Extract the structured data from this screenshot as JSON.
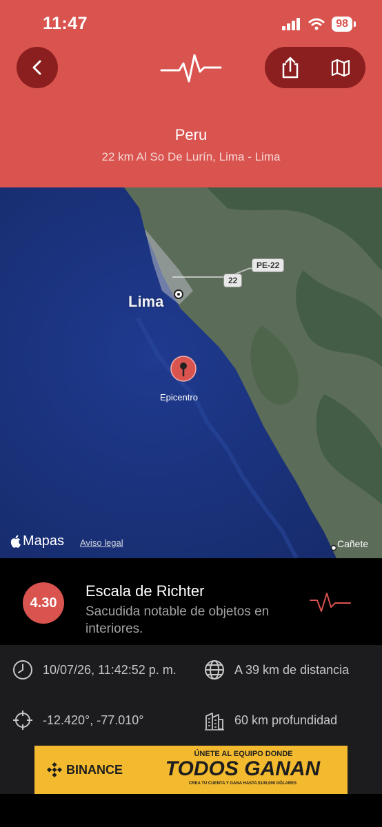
{
  "status_bar": {
    "time": "11:47",
    "battery": "98"
  },
  "header": {
    "title": "Peru",
    "subtitle": "22 km Al So De Lurín, Lima - Lima",
    "accent_color": "#d9534f",
    "icons": {
      "back": "chevron-left-icon",
      "logo": "heartbeat-icon",
      "share": "share-icon",
      "map": "map-icon"
    }
  },
  "map": {
    "city_label": "Lima",
    "epicenter_label": "Epicentro",
    "road_labels": [
      "PE-22",
      "22"
    ],
    "town_label": "Cañete",
    "attribution": "Mapas",
    "legal_link": "Aviso legal"
  },
  "quake": {
    "magnitude": "4.30",
    "scale_title": "Escala de Richter",
    "scale_desc": "Sacudida notable de objetos en interiores."
  },
  "details": {
    "datetime": "10/07/26, 11:42:52 p. m.",
    "distance": "A 39 km de distancia",
    "coords": "-12.420°, -77.010°",
    "depth": "60 km profundidad"
  },
  "ad": {
    "brand": "BINANCE",
    "top_line": "ÚNETE AL EQUIPO DONDE",
    "headline": "TODOS GANAN",
    "fine_print": "CREA TU CUENTA Y GANA HASTA $100,000 DÓLARES"
  }
}
